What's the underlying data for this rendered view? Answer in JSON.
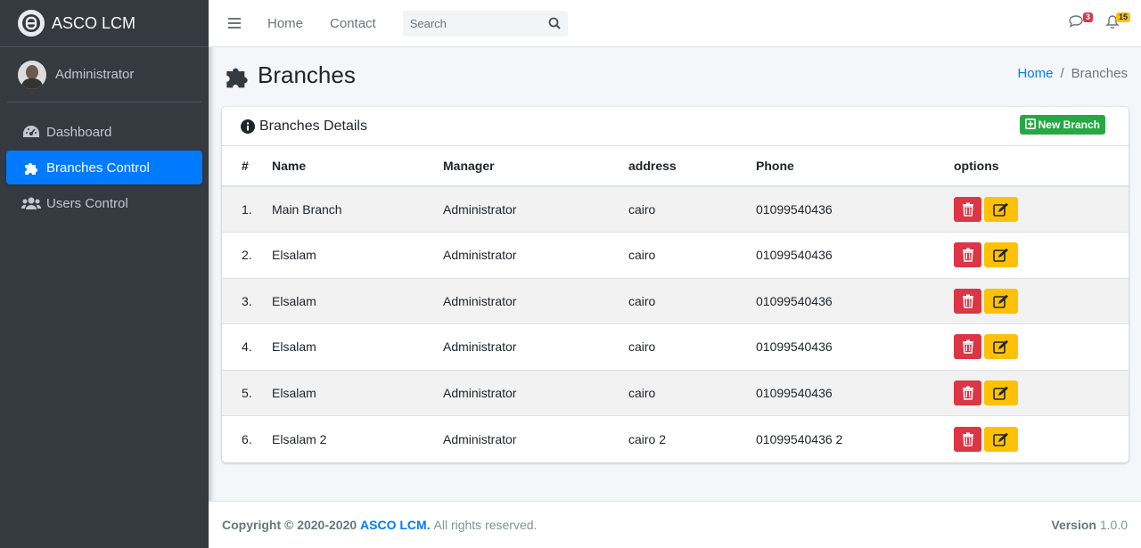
{
  "brand": {
    "name": "ASCO LCM"
  },
  "user": {
    "name": "Administrator"
  },
  "sidebar": {
    "items": [
      {
        "label": "Dashboard",
        "icon": "dashboard-gauge-icon"
      },
      {
        "label": "Branches Control",
        "icon": "puzzle-icon",
        "active": true
      },
      {
        "label": "Users Control",
        "icon": "users-icon"
      }
    ]
  },
  "topbar": {
    "links": [
      "Home",
      "Contact"
    ],
    "search_placeholder": "Search",
    "messages_count": "3",
    "notifications_count": "15"
  },
  "page": {
    "title": "Branches",
    "breadcrumb": {
      "home": "Home",
      "separator": "/",
      "current": "Branches"
    }
  },
  "card": {
    "title": "Branches Details",
    "new_button": "New Branch",
    "columns": [
      "#",
      "Name",
      "Manager",
      "address",
      "Phone",
      "options"
    ],
    "rows": [
      {
        "num": "1.",
        "name": "Main Branch",
        "manager": "Administrator",
        "address": "cairo",
        "phone": "01099540436"
      },
      {
        "num": "2.",
        "name": "Elsalam",
        "manager": "Administrator",
        "address": "cairo",
        "phone": "01099540436"
      },
      {
        "num": "3.",
        "name": "Elsalam",
        "manager": "Administrator",
        "address": "cairo",
        "phone": "01099540436"
      },
      {
        "num": "4.",
        "name": "Elsalam",
        "manager": "Administrator",
        "address": "cairo",
        "phone": "01099540436"
      },
      {
        "num": "5.",
        "name": "Elsalam",
        "manager": "Administrator",
        "address": "cairo",
        "phone": "01099540436"
      },
      {
        "num": "6.",
        "name": "Elsalam 2",
        "manager": "Administrator",
        "address": "cairo 2",
        "phone": "01099540436 2"
      }
    ]
  },
  "footer": {
    "copyright": "Copyright © 2020-2020",
    "company": "ASCO LCM.",
    "rights": "All rights reserved.",
    "version_label": "Version",
    "version": "1.0.0"
  },
  "colors": {
    "sidebar_bg": "#343a40",
    "accent": "#007bff",
    "success": "#28a745",
    "danger": "#dc3545",
    "warning": "#ffc107"
  }
}
